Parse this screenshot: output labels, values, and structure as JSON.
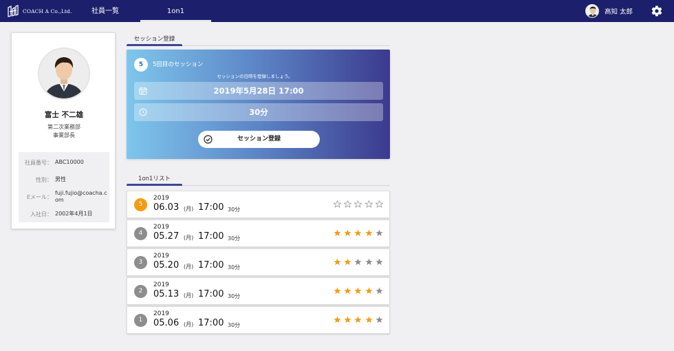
{
  "nav": {
    "logo_text": "COACH A Co.,Ltd.",
    "tabs": [
      {
        "label": "社員一覧",
        "active": false
      },
      {
        "label": "1on1",
        "active": true
      }
    ],
    "user_name": "高知 太郎"
  },
  "profile": {
    "name": "富士 不二雄",
    "department": "第二次業務部",
    "role": "事業部長",
    "fields": [
      {
        "key": "社員番号：",
        "value": "ABC10000"
      },
      {
        "key": "性別：",
        "value": "男性"
      },
      {
        "key": "Eメール：",
        "value": "fuji.fujio@coacha.com"
      },
      {
        "key": "入社日：",
        "value": "2002年4月1日"
      }
    ]
  },
  "session": {
    "section_label": "セッション登録",
    "number": "5",
    "title": "5回目のセッション",
    "hint": "セッションの日時を登録しましょう。",
    "datetime": "2019年5月28日 17:00",
    "duration": "30分",
    "register_label": "セッション登録"
  },
  "list": {
    "section_label": "1on1リスト",
    "items": [
      {
        "num": "5",
        "year": "2019",
        "date": "06.03",
        "day": "(月)",
        "time": "17:00",
        "duration": "30分",
        "rating": 0,
        "current": true
      },
      {
        "num": "4",
        "year": "2019",
        "date": "05.27",
        "day": "(月)",
        "time": "17:00",
        "duration": "30分",
        "rating": 4,
        "current": false
      },
      {
        "num": "3",
        "year": "2019",
        "date": "05.20",
        "day": "(月)",
        "time": "17:00",
        "duration": "30分",
        "rating": 2,
        "current": false
      },
      {
        "num": "2",
        "year": "2019",
        "date": "05.13",
        "day": "(月)",
        "time": "17:00",
        "duration": "30分",
        "rating": 4,
        "current": false
      },
      {
        "num": "1",
        "year": "2019",
        "date": "05.06",
        "day": "(月)",
        "time": "17:00",
        "duration": "30分",
        "rating": 4,
        "current": false
      }
    ]
  },
  "colors": {
    "nav_bg": "#1c1f6b",
    "accent": "#3d4494",
    "star_filled": "#f39c12",
    "star_empty": "#8d8d8d",
    "current_badge": "#f39c12"
  }
}
